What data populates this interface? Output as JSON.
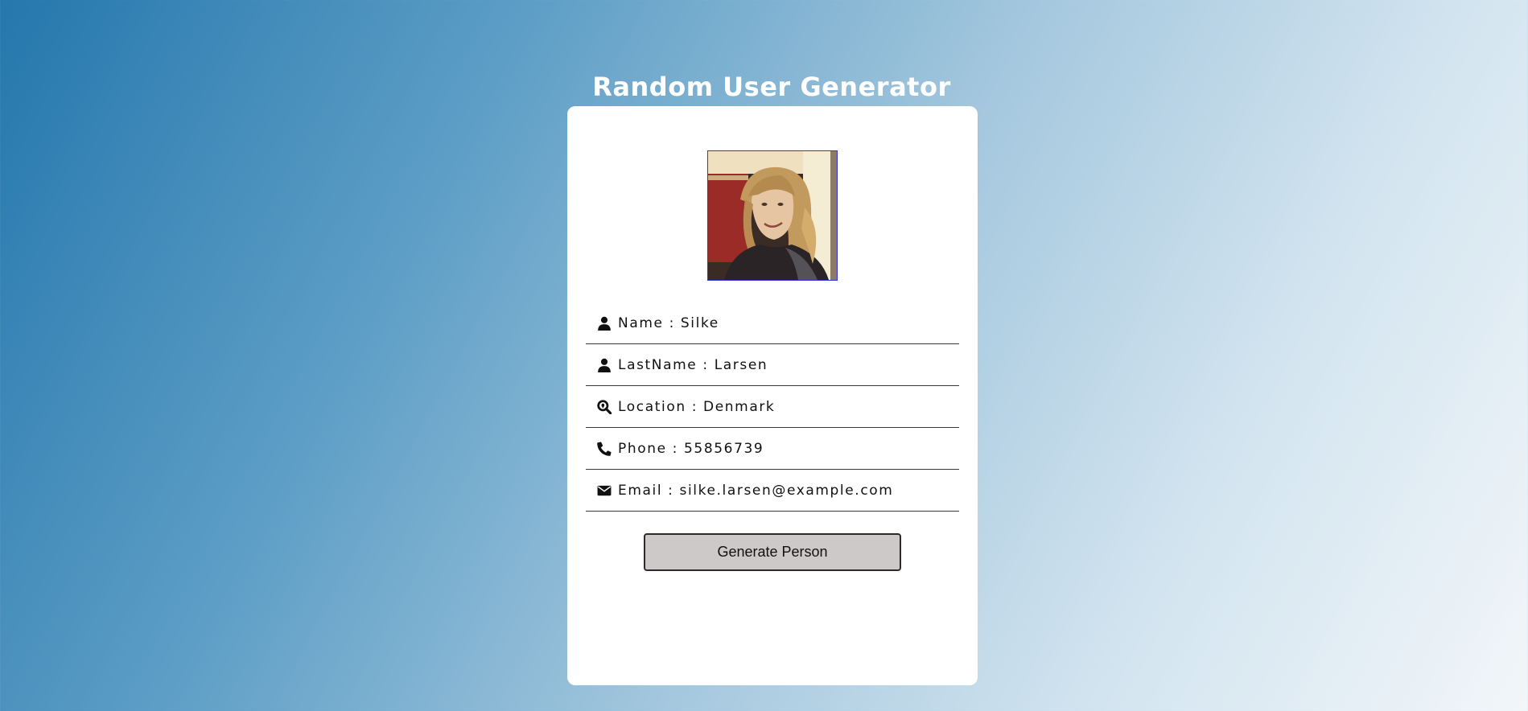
{
  "header": {
    "title": "Random User Generator"
  },
  "profile": {
    "fields": [
      {
        "icon": "user-icon",
        "label": "Name",
        "separator": " : ",
        "value": "Silke"
      },
      {
        "icon": "user-icon",
        "label": "LastName",
        "separator": " : ",
        "value": "Larsen"
      },
      {
        "icon": "search-location-icon",
        "label": "Location",
        "separator": " : ",
        "value": "Denmark"
      },
      {
        "icon": "phone-icon",
        "label": "Phone",
        "separator": " : ",
        "value": "55856739"
      },
      {
        "icon": "envelope-icon",
        "label": "Email",
        "separator": " : ",
        "value": "silke.larsen@example.com"
      }
    ]
  },
  "actions": {
    "generate_label": "Generate Person"
  },
  "colors": {
    "gradient_start": "#2577ad",
    "gradient_end": "#f2f6f9",
    "card_background": "#ffffff",
    "button_background": "#cdc9c9",
    "avatar_border": "#3535d8"
  }
}
